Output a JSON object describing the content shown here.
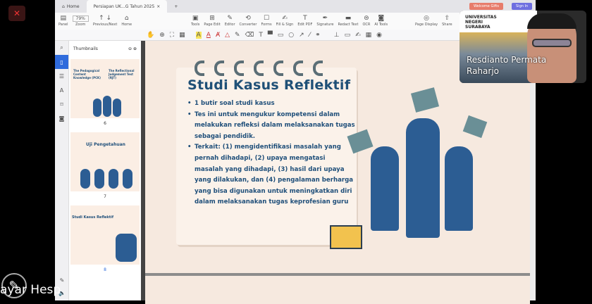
{
  "meeting": {
    "mic_icon": "mic-muted-icon",
    "participant_name": "Resdianto Permata\nRaharjo",
    "presenter_name": "ayar Hesp",
    "annotate_icon": "pencil-icon",
    "org_logo_text": "UNIVERSITAS\nNEGERI\nSURABAYA"
  },
  "app": {
    "tabs": [
      {
        "label": "Home"
      },
      {
        "label": "Persiapan UK...G Tahun 2025"
      }
    ],
    "new_tab": "+",
    "badges": {
      "welcome": "Welcome Gifts",
      "signin": "Sign In"
    }
  },
  "toolbar": {
    "panel": "Panel",
    "zoom_value": "79%",
    "zoom": "Zoom",
    "prevnext": "Previous/Next",
    "home": "Home",
    "tools": [
      "Tools",
      "Page Edit",
      "Editor",
      "Converter",
      "Forms",
      "Fill & Sign",
      "Edit PDF",
      "Signature",
      "Redact Text",
      "OCR",
      "AI Tools"
    ],
    "page_display": "Page Display",
    "share": "Share"
  },
  "thumbnails": {
    "title": "Thumbnails",
    "pages": [
      "6",
      "7"
    ],
    "page_8_label": "8"
  },
  "slide": {
    "title": "Studi Kasus Reflektif",
    "bullets": [
      "1 butir soal studi kasus",
      "Tes ini untuk mengukur kompetensi dalam melakukan refleksi dalam melaksanakan tugas sebagai pendidik.",
      "Terkait: (1) mengidentifikasi masalah yang pernah dihadapi, (2) upaya mengatasi masalah yang dihadapi, (3) hasil dari upaya yang dilakukan, dan (4) pengalaman berharga yang bisa digunakan untuk meningkatkan diri dalam melaksanakan tugas keprofesian guru"
    ]
  },
  "thumb_text": {
    "p6a": "The Pedagogical Content Knowledge (PCK)",
    "p6b": "The Reflectional Judgement Test (RJT)",
    "p7": "Uji Pengetahuan",
    "p8": "Studi Kasus Reflektif"
  },
  "colors": {
    "accent": "#2f6bdc",
    "slide_bg": "#f6e9df",
    "title": "#1f5077"
  }
}
